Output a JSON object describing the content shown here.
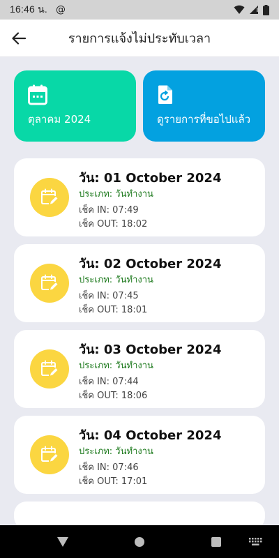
{
  "status_bar": {
    "time": "16:46 น.",
    "colors": {
      "bg": "#d3d3d3"
    }
  },
  "header": {
    "title": "รายการแจ้งไม่ประทับเวลา"
  },
  "top_cards": [
    {
      "label": "ตุลาคม 2024",
      "icon": "calendar-icon",
      "color": "#08d8a7"
    },
    {
      "label": "ดูรายการที่ขอไปแล้ว",
      "icon": "history-icon",
      "color": "#03a1e0"
    }
  ],
  "days": [
    {
      "date": "วัน: 01 October 2024",
      "type": "ประเภท: วันทำงาน",
      "check_in": "เช็ค IN: 07:49",
      "check_out": "เช็ค OUT: 18:02"
    },
    {
      "date": "วัน: 02 October 2024",
      "type": "ประเภท: วันทำงาน",
      "check_in": "เช็ค IN: 07:45",
      "check_out": "เช็ค OUT: 18:01"
    },
    {
      "date": "วัน: 03 October 2024",
      "type": "ประเภท: วันทำงาน",
      "check_in": "เช็ค IN: 07:44",
      "check_out": "เช็ค OUT: 18:06"
    },
    {
      "date": "วัน: 04 October 2024",
      "type": "ประเภท: วันทำงาน",
      "check_in": "เช็ค IN: 07:46",
      "check_out": "เช็ค OUT: 17:01"
    }
  ],
  "colors": {
    "badge": "#fbd641",
    "type_text": "#1e7a1e",
    "background": "#e9eaf1"
  }
}
